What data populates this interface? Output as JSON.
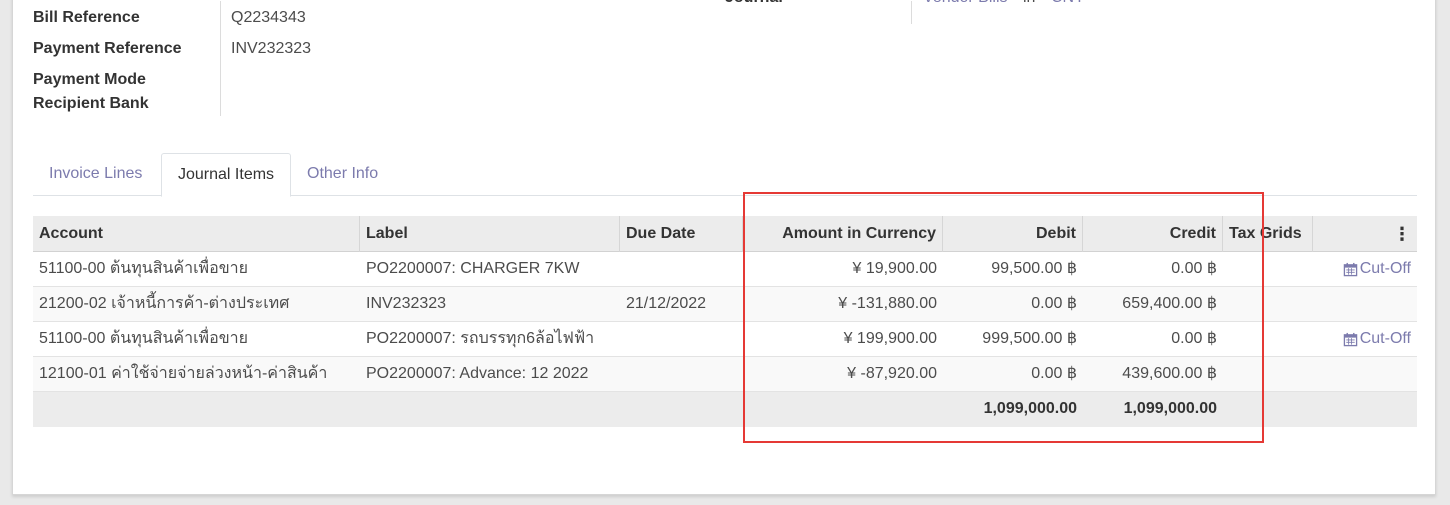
{
  "header": {
    "bill_reference_label": "Bill Reference",
    "bill_reference_value": "Q2234343",
    "payment_reference_label": "Payment Reference",
    "payment_reference_value": "INV232323",
    "payment_mode_label": "Payment Mode",
    "recipient_bank_label": "Recipient Bank",
    "journal_label": "Journal",
    "journal_value": "Vendor Bills",
    "journal_in": "in",
    "journal_currency": "CNY"
  },
  "tabs": [
    {
      "label": "Invoice Lines"
    },
    {
      "label": "Journal Items"
    },
    {
      "label": "Other Info"
    }
  ],
  "table": {
    "columns": {
      "account": "Account",
      "label": "Label",
      "due_date": "Due Date",
      "amount_currency": "Amount in Currency",
      "debit": "Debit",
      "credit": "Credit",
      "tax_grids": "Tax Grids",
      "options": "⋮"
    },
    "rows": [
      {
        "account": "51100-00 ต้นทุนสินค้าเพื่อขาย",
        "label": "PO2200007: CHARGER 7KW",
        "due_date": "",
        "amount_currency": "¥ 19,900.00",
        "debit": "99,500.00 ฿",
        "credit": "0.00 ฿",
        "action": "Cut-Off"
      },
      {
        "account": "21200-02 เจ้าหนี้การค้า-ต่างประเทศ",
        "label": "INV232323",
        "due_date": "21/12/2022",
        "amount_currency": "¥ -131,880.00",
        "debit": "0.00 ฿",
        "credit": "659,400.00 ฿",
        "action": ""
      },
      {
        "account": "51100-00 ต้นทุนสินค้าเพื่อขาย",
        "label": "PO2200007: รถบรรทุก6ล้อไฟฟ้า",
        "due_date": "",
        "amount_currency": "¥ 199,900.00",
        "debit": "999,500.00 ฿",
        "credit": "0.00 ฿",
        "action": "Cut-Off"
      },
      {
        "account": "12100-01 ค่าใช้จ่ายจ่ายล่วงหน้า-ค่าสินค้า",
        "label": "PO2200007: Advance: 12 2022",
        "due_date": "",
        "amount_currency": "¥ -87,920.00",
        "debit": "0.00 ฿",
        "credit": "439,600.00 ฿",
        "action": ""
      }
    ],
    "totals": {
      "debit": "1,099,000.00",
      "credit": "1,099,000.00"
    }
  },
  "colors": {
    "link": "#7c7bad",
    "highlight": "#e53935"
  }
}
